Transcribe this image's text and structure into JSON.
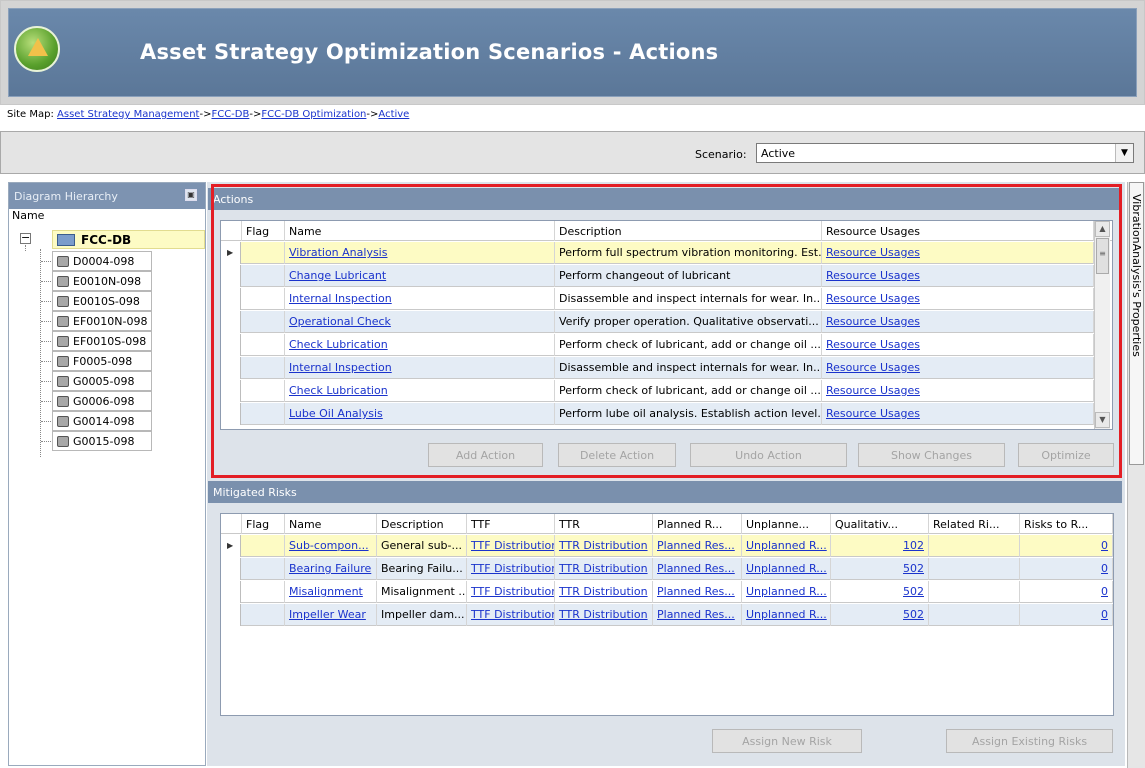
{
  "header": {
    "title": "Asset Strategy Optimization Scenarios  - Actions"
  },
  "sitemap": {
    "prefix": "Site Map:",
    "links": [
      "Asset Strategy Management",
      "FCC-DB",
      "FCC-DB Optimization",
      "Active"
    ],
    "sep": "->"
  },
  "scenario": {
    "label": "Scenario:",
    "value": "Active"
  },
  "left_panel": {
    "title": "Diagram Hierarchy",
    "column": "Name",
    "root": "FCC-DB",
    "items": [
      "D0004-098",
      "E0010N-098",
      "E0010S-098",
      "EF0010N-098",
      "EF0010S-098",
      "F0005-098",
      "G0005-098",
      "G0006-098",
      "G0014-098",
      "G0015-098"
    ]
  },
  "side_tab": {
    "label": "VibrationAnalysis's Properties"
  },
  "actions_panel": {
    "title": "Actions",
    "columns": [
      "Flag",
      "Name",
      "Description",
      "Resource Usages"
    ],
    "rows": [
      {
        "name": "Vibration Analysis",
        "desc": "Perform full spectrum vibration monitoring. Est...",
        "res": "Resource Usages"
      },
      {
        "name": "Change Lubricant",
        "desc": "Perform changeout of lubricant",
        "res": "Resource Usages"
      },
      {
        "name": "Internal Inspection",
        "desc": "Disassemble and inspect internals for wear. In...",
        "res": "Resource Usages"
      },
      {
        "name": "Operational Check",
        "desc": "Verify proper operation.  Qualitative observati...",
        "res": "Resource Usages"
      },
      {
        "name": "Check Lubrication",
        "desc": "Perform check of lubricant, add or change oil ...",
        "res": "Resource Usages"
      },
      {
        "name": "Internal Inspection",
        "desc": "Disassemble and inspect internals for wear. In...",
        "res": "Resource Usages"
      },
      {
        "name": "Check Lubrication",
        "desc": "Perform check of lubricant, add or change oil ...",
        "res": "Resource Usages"
      },
      {
        "name": "Lube Oil Analysis",
        "desc": "Perform lube oil analysis. Establish action level...",
        "res": "Resource Usages"
      }
    ],
    "buttons": [
      "Add Action",
      "Delete Action",
      "Undo Action",
      "Show Changes",
      "Optimize"
    ]
  },
  "risks_panel": {
    "title": "Mitigated Risks",
    "columns": [
      "Flag",
      "Name",
      "Description",
      "TTF",
      "TTR",
      "Planned R...",
      "Unplanne...",
      "Qualitativ...",
      "Related Ri...",
      "Risks to R..."
    ],
    "rows": [
      {
        "name": "Sub-compon...",
        "desc": "General sub-...",
        "ttf": "TTF Distribution",
        "ttr": "TTR Distribution",
        "planned": "Planned Res...",
        "unplanned": "Unplanned R...",
        "qual": "102",
        "related": "",
        "risks": "0"
      },
      {
        "name": "Bearing Failure",
        "desc": "Bearing Failu...",
        "ttf": "TTF Distribution",
        "ttr": "TTR Distribution",
        "planned": "Planned Res...",
        "unplanned": "Unplanned R...",
        "qual": "502",
        "related": "",
        "risks": "0"
      },
      {
        "name": "Misalignment",
        "desc": "Misalignment ...",
        "ttf": "TTF Distribution",
        "ttr": "TTR Distribution",
        "planned": "Planned Res...",
        "unplanned": "Unplanned R...",
        "qual": "502",
        "related": "",
        "risks": "0"
      },
      {
        "name": "Impeller Wear",
        "desc": "Impeller dam...",
        "ttf": "TTF Distribution",
        "ttr": "TTR Distribution",
        "planned": "Planned Res...",
        "unplanned": "Unplanned R...",
        "qual": "502",
        "related": "",
        "risks": "0"
      }
    ],
    "buttons": [
      "Assign New Risk",
      "Assign Existing Risks"
    ]
  },
  "colors": {
    "banner": "#5f7d9f",
    "panel_header": "#7a90ad",
    "selected_row": "#fdfbc4",
    "alt_row": "#e4ecf5",
    "highlight_box": "#e31e25",
    "link": "#1a33cc"
  }
}
